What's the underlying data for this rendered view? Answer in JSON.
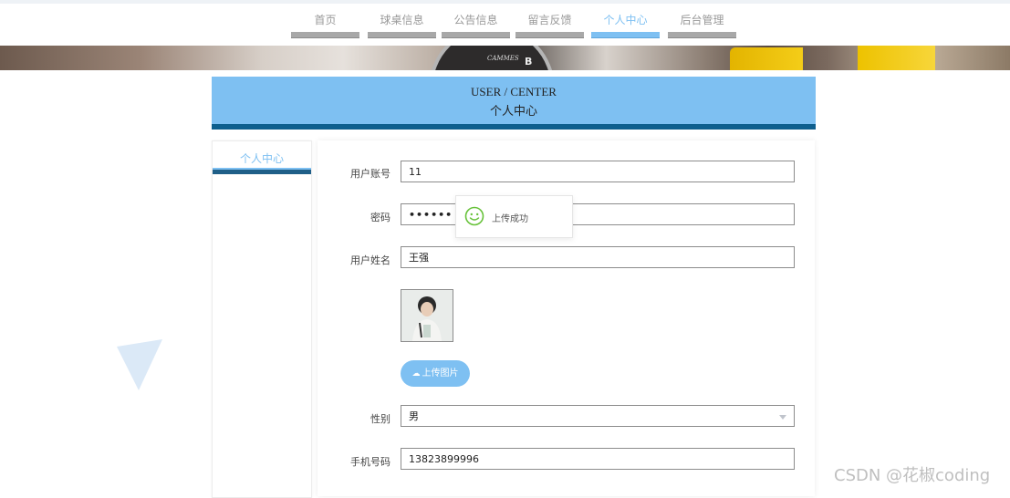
{
  "nav": {
    "items": [
      {
        "label": "首页"
      },
      {
        "label": "球桌信息"
      },
      {
        "label": "公告信息"
      },
      {
        "label": "留言反馈"
      },
      {
        "label": "个人中心"
      },
      {
        "label": "后台管理"
      }
    ],
    "active_index": 4
  },
  "banner": {
    "gauge_text": "CAMMES",
    "gauge_letter": "B"
  },
  "header": {
    "title_en": "USER / CENTER",
    "title_cn": "个人中心"
  },
  "sidebar": {
    "items": [
      {
        "label": "个人中心"
      }
    ]
  },
  "form": {
    "account_label": "用户账号",
    "account_value": "11",
    "password_label": "密码",
    "password_value": "••••••",
    "name_label": "用户姓名",
    "name_value": "王强",
    "upload_label": "上传图片",
    "gender_label": "性别",
    "gender_value": "男",
    "phone_label": "手机号码",
    "phone_value": "13823899996"
  },
  "toast": {
    "message": "上传成功"
  },
  "watermark": "CSDN @花椒coding",
  "colors": {
    "accent": "#7ec0f2",
    "header_bottom": "#0e5f8e",
    "toast_icon": "#67c23a"
  }
}
